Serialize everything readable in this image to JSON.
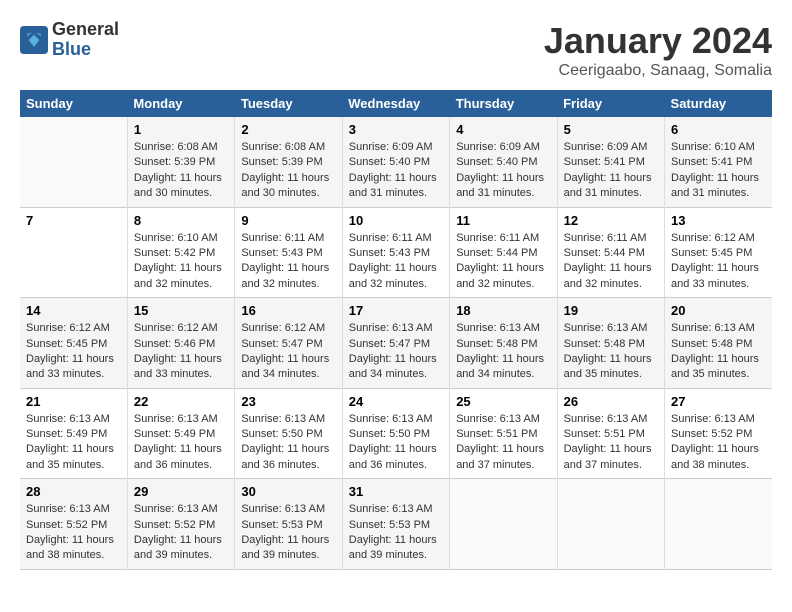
{
  "logo": {
    "general": "General",
    "blue": "Blue"
  },
  "title": "January 2024",
  "subtitle": "Ceerigaabo, Sanaag, Somalia",
  "weekdays": [
    "Sunday",
    "Monday",
    "Tuesday",
    "Wednesday",
    "Thursday",
    "Friday",
    "Saturday"
  ],
  "weeks": [
    [
      {
        "day": "",
        "info": ""
      },
      {
        "day": "1",
        "info": "Sunrise: 6:08 AM\nSunset: 5:39 PM\nDaylight: 11 hours\nand 30 minutes."
      },
      {
        "day": "2",
        "info": "Sunrise: 6:08 AM\nSunset: 5:39 PM\nDaylight: 11 hours\nand 30 minutes."
      },
      {
        "day": "3",
        "info": "Sunrise: 6:09 AM\nSunset: 5:40 PM\nDaylight: 11 hours\nand 31 minutes."
      },
      {
        "day": "4",
        "info": "Sunrise: 6:09 AM\nSunset: 5:40 PM\nDaylight: 11 hours\nand 31 minutes."
      },
      {
        "day": "5",
        "info": "Sunrise: 6:09 AM\nSunset: 5:41 PM\nDaylight: 11 hours\nand 31 minutes."
      },
      {
        "day": "6",
        "info": "Sunrise: 6:10 AM\nSunset: 5:41 PM\nDaylight: 11 hours\nand 31 minutes."
      }
    ],
    [
      {
        "day": "7",
        "info": ""
      },
      {
        "day": "8",
        "info": "Sunrise: 6:10 AM\nSunset: 5:42 PM\nDaylight: 11 hours\nand 32 minutes."
      },
      {
        "day": "9",
        "info": "Sunrise: 6:11 AM\nSunset: 5:43 PM\nDaylight: 11 hours\nand 32 minutes."
      },
      {
        "day": "10",
        "info": "Sunrise: 6:11 AM\nSunset: 5:43 PM\nDaylight: 11 hours\nand 32 minutes."
      },
      {
        "day": "11",
        "info": "Sunrise: 6:11 AM\nSunset: 5:44 PM\nDaylight: 11 hours\nand 32 minutes."
      },
      {
        "day": "12",
        "info": "Sunrise: 6:11 AM\nSunset: 5:44 PM\nDaylight: 11 hours\nand 32 minutes."
      },
      {
        "day": "13",
        "info": "Sunrise: 6:12 AM\nSunset: 5:45 PM\nDaylight: 11 hours\nand 33 minutes."
      }
    ],
    [
      {
        "day": "14",
        "info": "Sunrise: 6:12 AM\nSunset: 5:45 PM\nDaylight: 11 hours\nand 33 minutes."
      },
      {
        "day": "15",
        "info": "Sunrise: 6:12 AM\nSunset: 5:46 PM\nDaylight: 11 hours\nand 33 minutes."
      },
      {
        "day": "16",
        "info": "Sunrise: 6:12 AM\nSunset: 5:47 PM\nDaylight: 11 hours\nand 34 minutes."
      },
      {
        "day": "17",
        "info": "Sunrise: 6:13 AM\nSunset: 5:47 PM\nDaylight: 11 hours\nand 34 minutes."
      },
      {
        "day": "18",
        "info": "Sunrise: 6:13 AM\nSunset: 5:48 PM\nDaylight: 11 hours\nand 34 minutes."
      },
      {
        "day": "19",
        "info": "Sunrise: 6:13 AM\nSunset: 5:48 PM\nDaylight: 11 hours\nand 35 minutes."
      },
      {
        "day": "20",
        "info": "Sunrise: 6:13 AM\nSunset: 5:48 PM\nDaylight: 11 hours\nand 35 minutes."
      }
    ],
    [
      {
        "day": "21",
        "info": "Sunrise: 6:13 AM\nSunset: 5:49 PM\nDaylight: 11 hours\nand 35 minutes."
      },
      {
        "day": "22",
        "info": "Sunrise: 6:13 AM\nSunset: 5:49 PM\nDaylight: 11 hours\nand 36 minutes."
      },
      {
        "day": "23",
        "info": "Sunrise: 6:13 AM\nSunset: 5:50 PM\nDaylight: 11 hours\nand 36 minutes."
      },
      {
        "day": "24",
        "info": "Sunrise: 6:13 AM\nSunset: 5:50 PM\nDaylight: 11 hours\nand 36 minutes."
      },
      {
        "day": "25",
        "info": "Sunrise: 6:13 AM\nSunset: 5:51 PM\nDaylight: 11 hours\nand 37 minutes."
      },
      {
        "day": "26",
        "info": "Sunrise: 6:13 AM\nSunset: 5:51 PM\nDaylight: 11 hours\nand 37 minutes."
      },
      {
        "day": "27",
        "info": "Sunrise: 6:13 AM\nSunset: 5:52 PM\nDaylight: 11 hours\nand 38 minutes."
      }
    ],
    [
      {
        "day": "28",
        "info": "Sunrise: 6:13 AM\nSunset: 5:52 PM\nDaylight: 11 hours\nand 38 minutes."
      },
      {
        "day": "29",
        "info": "Sunrise: 6:13 AM\nSunset: 5:52 PM\nDaylight: 11 hours\nand 39 minutes."
      },
      {
        "day": "30",
        "info": "Sunrise: 6:13 AM\nSunset: 5:53 PM\nDaylight: 11 hours\nand 39 minutes."
      },
      {
        "day": "31",
        "info": "Sunrise: 6:13 AM\nSunset: 5:53 PM\nDaylight: 11 hours\nand 39 minutes."
      },
      {
        "day": "",
        "info": ""
      },
      {
        "day": "",
        "info": ""
      },
      {
        "day": "",
        "info": ""
      }
    ]
  ]
}
